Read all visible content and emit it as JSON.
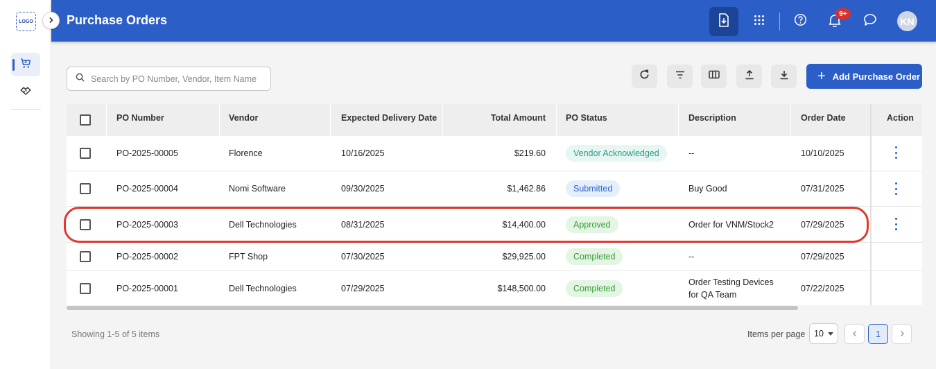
{
  "app": {
    "logo_text": "LOGO"
  },
  "header": {
    "title": "Purchase Orders",
    "notifications_badge": "9+",
    "avatar_initials": "KN"
  },
  "toolbar": {
    "search_placeholder": "Search by PO Number, Vendor, Item Name",
    "add_button_label": "Add Purchase Order"
  },
  "table": {
    "columns": [
      "PO Number",
      "Vendor",
      "Expected Delivery Date",
      "Total Amount",
      "PO Status",
      "Description",
      "Order Date",
      "Action"
    ],
    "rows": [
      {
        "po_number": "PO-2025-00005",
        "vendor": "Florence",
        "expected_delivery": "10/16/2025",
        "total": "$219.60",
        "status": "Vendor Acknowledged",
        "description": "--",
        "description2": "",
        "order_date": "10/10/2025"
      },
      {
        "po_number": "PO-2025-00004",
        "vendor": "Nomi Software",
        "expected_delivery": "09/30/2025",
        "total": "$1,462.86",
        "status": "Submitted",
        "description": "Buy Good",
        "description2": "",
        "order_date": "07/31/2025"
      },
      {
        "po_number": "PO-2025-00003",
        "vendor": "Dell Technologies",
        "expected_delivery": "08/31/2025",
        "total": "$14,400.00",
        "status": "Approved",
        "description": "Order for VNM/Stock2",
        "description2": "",
        "order_date": "07/29/2025"
      },
      {
        "po_number": "PO-2025-00002",
        "vendor": "FPT Shop",
        "expected_delivery": "07/30/2025",
        "total": "$29,925.00",
        "status": "Completed",
        "description": "--",
        "description2": "",
        "order_date": "07/29/2025"
      },
      {
        "po_number": "PO-2025-00001",
        "vendor": "Dell Technologies",
        "expected_delivery": "07/29/2025",
        "total": "$148,500.00",
        "status": "Completed",
        "description": "Order Testing Devices",
        "description2": "for QA Team",
        "order_date": "07/22/2025"
      }
    ]
  },
  "footer": {
    "showing": "Showing 1-5 of 5 items",
    "items_per_page_label": "Items per page",
    "items_per_page_value": "10",
    "current_page": "1"
  },
  "colors": {
    "primary": "#2c5ec7",
    "highlight": "#e1372c",
    "status_acknowledged": "#2b9a86",
    "status_submitted": "#2c63c9",
    "status_approved": "#3a9a3a",
    "status_completed": "#3a9a3a"
  }
}
